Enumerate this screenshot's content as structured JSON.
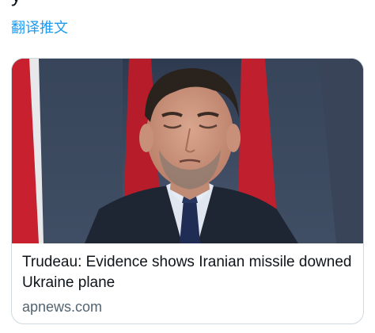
{
  "tweet": {
    "text_tail": "y"
  },
  "translate": {
    "label": "翻译推文"
  },
  "card": {
    "image_alt": "Trudeau",
    "title": "Trudeau: Evidence shows Iranian missile downed Ukraine plane",
    "domain": "apnews.com"
  },
  "colors": {
    "link": "#1d9bf0",
    "title": "#0f1419",
    "domain": "#536471",
    "border": "#cfd9de"
  }
}
